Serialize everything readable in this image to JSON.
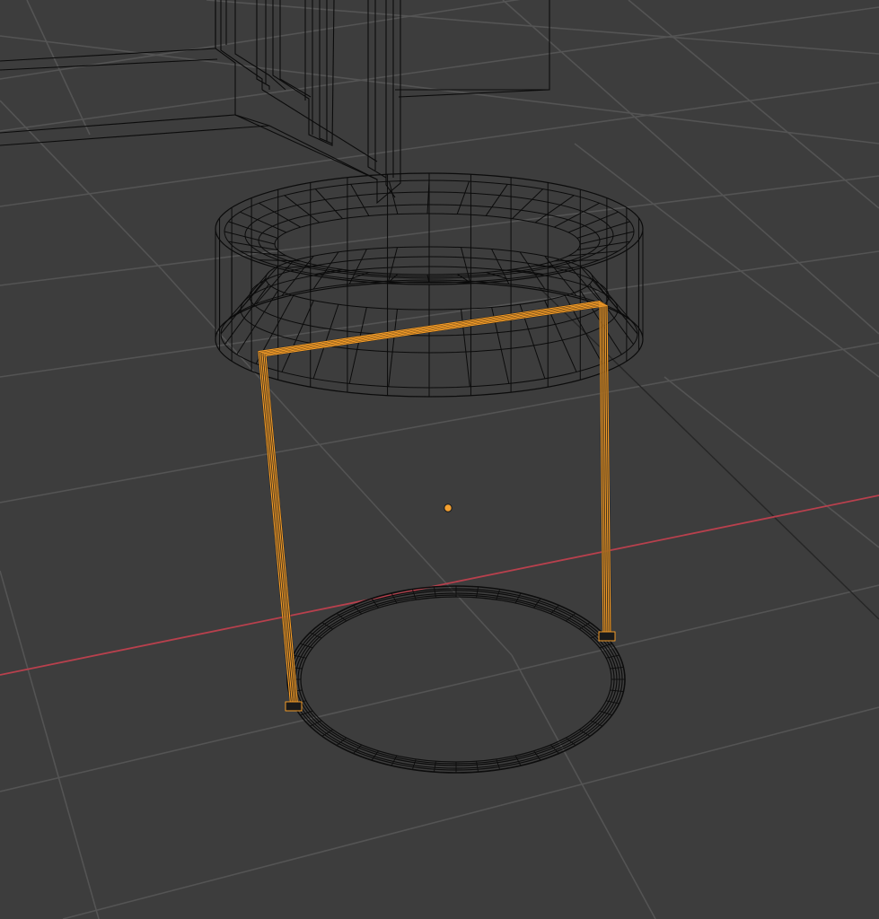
{
  "viewport": {
    "mode": "wireframe",
    "colors": {
      "background": "#3d3d3d",
      "grid": "#545454",
      "x_axis": "#b8404d",
      "wire": "#0b0b0b",
      "selection": "#f29b28",
      "origin": "#f4a030"
    }
  },
  "scene": {
    "objects": [
      {
        "name": "stool-legs",
        "selected": true,
        "display": "wireframe"
      },
      {
        "name": "stool-seat",
        "selected": false,
        "display": "wireframe"
      },
      {
        "name": "base-ring",
        "selected": false,
        "display": "wireframe"
      },
      {
        "name": "cabinet",
        "selected": false,
        "display": "wireframe"
      }
    ],
    "active_object_origin": {
      "visible": true
    }
  }
}
